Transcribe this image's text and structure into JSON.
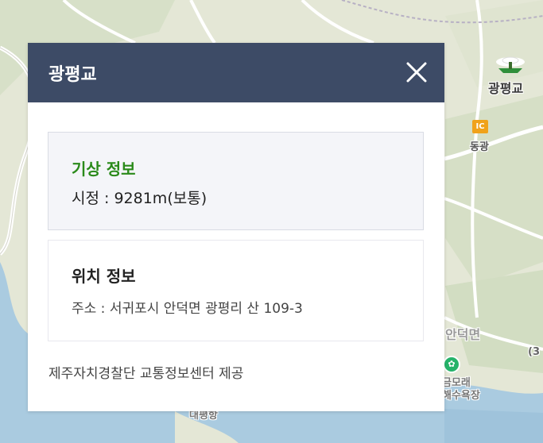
{
  "map": {
    "poi_name": "광평교",
    "ic_badge": "IC",
    "ic_name": "동광",
    "town_label": "안덕면",
    "route_label": "(3",
    "beach_label_1": "금모래",
    "beach_label_2": "해수욕장",
    "bottom_label": "대평항",
    "poi_pin_icon": "leaf-pin-icon",
    "colors": {
      "land": "#e6e8d8",
      "land_green": "#cfdcc0",
      "sea": "#a9cbe0",
      "road": "#ffffff",
      "road_outline": "#c9c9c0"
    }
  },
  "popup": {
    "title": "광평교",
    "close_icon": "close-icon",
    "weather": {
      "title": "기상 정보",
      "label": "시정 : ",
      "value": "9281m(보통)"
    },
    "location": {
      "title": "위치 정보",
      "address": "주소 : 서귀포시 안덕면 광평리 산 109-3"
    },
    "footer": "제주자치경찰단 교통정보센터 제공",
    "colors": {
      "header_bg": "#3d4b66",
      "weather_title": "#2a8a1a"
    }
  }
}
